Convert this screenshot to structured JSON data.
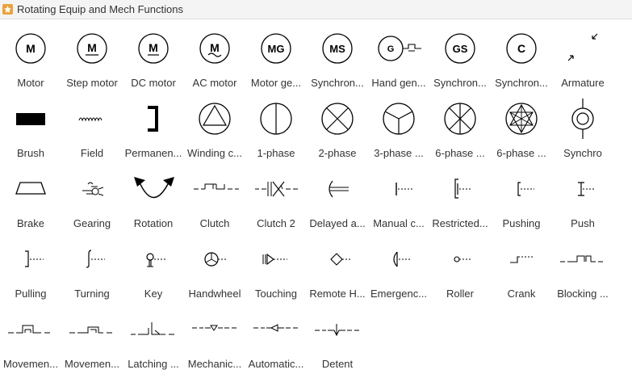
{
  "header": {
    "title": "Rotating Equip and Mech Functions"
  },
  "shapes": [
    {
      "label": "Motor",
      "icon": "motor-icon"
    },
    {
      "label": "Step motor",
      "icon": "step-motor-icon"
    },
    {
      "label": "DC motor",
      "icon": "dc-motor-icon"
    },
    {
      "label": "AC motor",
      "icon": "ac-motor-icon"
    },
    {
      "label": "Motor ge...",
      "icon": "motor-generator-icon"
    },
    {
      "label": "Synchron...",
      "icon": "synchronous-motor-icon"
    },
    {
      "label": "Hand gen...",
      "icon": "hand-generator-icon"
    },
    {
      "label": "Synchron...",
      "icon": "synchronous-generator-icon"
    },
    {
      "label": "Synchron...",
      "icon": "synchronous-converter-icon"
    },
    {
      "label": "Armature",
      "icon": "armature-icon"
    },
    {
      "label": "Brush",
      "icon": "brush-icon"
    },
    {
      "label": "Field",
      "icon": "field-icon"
    },
    {
      "label": "Permanen...",
      "icon": "permanent-magnet-icon"
    },
    {
      "label": "Winding c...",
      "icon": "winding-connection-icon"
    },
    {
      "label": "1-phase",
      "icon": "one-phase-icon"
    },
    {
      "label": "2-phase",
      "icon": "two-phase-icon"
    },
    {
      "label": "3-phase ...",
      "icon": "three-phase-icon"
    },
    {
      "label": "6-phase ...",
      "icon": "six-phase-icon"
    },
    {
      "label": "6-phase ...",
      "icon": "six-phase-star-icon"
    },
    {
      "label": "Synchro",
      "icon": "synchro-icon"
    },
    {
      "label": "Brake",
      "icon": "brake-icon"
    },
    {
      "label": "Gearing",
      "icon": "gearing-icon"
    },
    {
      "label": "Rotation",
      "icon": "rotation-icon"
    },
    {
      "label": "Clutch",
      "icon": "clutch-icon"
    },
    {
      "label": "Clutch 2",
      "icon": "clutch-2-icon"
    },
    {
      "label": "Delayed a...",
      "icon": "delayed-action-icon"
    },
    {
      "label": "Manual c...",
      "icon": "manual-control-icon"
    },
    {
      "label": "Restricted...",
      "icon": "restricted-icon"
    },
    {
      "label": "Pushing",
      "icon": "pushing-icon"
    },
    {
      "label": "Push",
      "icon": "push-icon"
    },
    {
      "label": "Pulling",
      "icon": "pulling-icon"
    },
    {
      "label": "Turning",
      "icon": "turning-icon"
    },
    {
      "label": "Key",
      "icon": "key-icon"
    },
    {
      "label": "Handwheel",
      "icon": "handwheel-icon"
    },
    {
      "label": "Touching",
      "icon": "touching-icon"
    },
    {
      "label": "Remote H...",
      "icon": "remote-hand-icon"
    },
    {
      "label": "Emergenc...",
      "icon": "emergency-icon"
    },
    {
      "label": "Roller",
      "icon": "roller-icon"
    },
    {
      "label": "Crank",
      "icon": "crank-icon"
    },
    {
      "label": "Blocking ...",
      "icon": "blocking-icon"
    },
    {
      "label": "Movemen...",
      "icon": "movement-1-icon"
    },
    {
      "label": "Movemen...",
      "icon": "movement-2-icon"
    },
    {
      "label": "Latching ...",
      "icon": "latching-icon"
    },
    {
      "label": "Mechanic...",
      "icon": "mechanical-icon"
    },
    {
      "label": "Automatic...",
      "icon": "automatic-icon"
    },
    {
      "label": "Detent",
      "icon": "detent-icon"
    }
  ],
  "colors": {
    "header_bg": "#f4f4f4",
    "stroke": "#000000",
    "label": "#333333",
    "logo": "#e8a33c"
  }
}
